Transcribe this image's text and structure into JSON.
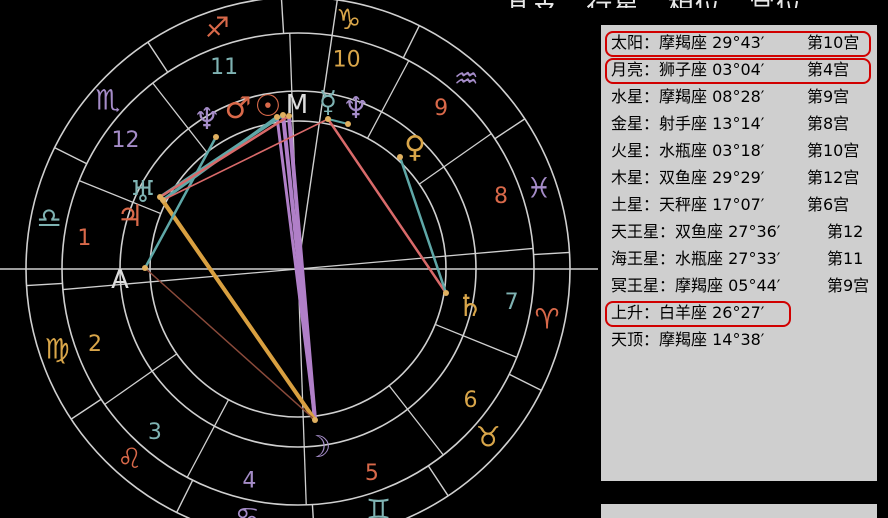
{
  "tabs": [
    "其支",
    "行星",
    "相位",
    "宫位"
  ],
  "planet_rows": [
    {
      "label": "太阳：摩羯座 29°43′",
      "house": "第10宫",
      "highlight": true
    },
    {
      "label": "月亮：狮子座 03°04′",
      "house": "第4宫",
      "highlight": true
    },
    {
      "label": "水星：摩羯座 08°28′",
      "house": "第9宫",
      "highlight": false
    },
    {
      "label": "金星：射手座 13°14′",
      "house": "第8宫",
      "highlight": false
    },
    {
      "label": "火星：水瓶座 03°18′",
      "house": "第10宫",
      "highlight": false
    },
    {
      "label": "木星：双鱼座 29°29′",
      "house": "第12宫",
      "highlight": false
    },
    {
      "label": "土星：天秤座 17°07′",
      "house": "第6宫",
      "highlight": false
    },
    {
      "label": "天王星：双鱼座 27°36′",
      "house": "第12",
      "highlight": false
    },
    {
      "label": "海王星：水瓶座 27°33′",
      "house": "第11",
      "highlight": false
    },
    {
      "label": "冥王星：摩羯座 05°44′",
      "house": "第9宫",
      "highlight": false
    },
    {
      "label": "上升：白羊座 26°27′",
      "house": "",
      "highlight": true
    },
    {
      "label": "天顶：摩羯座 14°38′",
      "house": "",
      "highlight": false
    }
  ],
  "wheel": {
    "zodiac_signs": [
      {
        "glyph": "♑",
        "color": "#d9a64a"
      },
      {
        "glyph": "♒",
        "color": "#a58cc8"
      },
      {
        "glyph": "♓",
        "color": "#a58cc8"
      },
      {
        "glyph": "♈",
        "color": "#d9694a"
      },
      {
        "glyph": "♉",
        "color": "#d9a64a"
      },
      {
        "glyph": "♊",
        "color": "#7fb3b3"
      },
      {
        "glyph": "♋",
        "color": "#a58cc8"
      },
      {
        "glyph": "♌",
        "color": "#d9694a"
      },
      {
        "glyph": "♍",
        "color": "#d9a64a"
      },
      {
        "glyph": "♎",
        "color": "#7fb3b3"
      },
      {
        "glyph": "♏",
        "color": "#a58cc8"
      },
      {
        "glyph": "♐",
        "color": "#d9694a"
      }
    ],
    "house_numbers": [
      {
        "label": "10",
        "color": "#d9a64a"
      },
      {
        "label": "9",
        "color": "#d9694a"
      },
      {
        "label": "8",
        "color": "#d9694a"
      },
      {
        "label": "7",
        "color": "#7fb3b3"
      },
      {
        "label": "6",
        "color": "#d9a64a"
      },
      {
        "label": "5",
        "color": "#d9694a"
      },
      {
        "label": "4",
        "color": "#a58cc8"
      },
      {
        "label": "3",
        "color": "#7fb3b3"
      },
      {
        "label": "2",
        "color": "#d9a64a"
      },
      {
        "label": "1",
        "color": "#d9694a"
      },
      {
        "label": "12",
        "color": "#a58cc8"
      },
      {
        "label": "11",
        "color": "#7fb3b3"
      }
    ],
    "planets": [
      {
        "name": "sun",
        "glyph": "☉",
        "color": "#d9694a"
      },
      {
        "name": "mars",
        "glyph": "♂",
        "color": "#d9694a"
      },
      {
        "name": "neptune-a",
        "glyph": "♆",
        "color": "#a58cc8"
      },
      {
        "name": "midheaven",
        "glyph": "M",
        "color": "#dddddd"
      },
      {
        "name": "mercury",
        "glyph": "☿",
        "color": "#7fb3b3"
      },
      {
        "name": "neptune-b",
        "glyph": "♆",
        "color": "#a58cc8"
      },
      {
        "name": "venus",
        "glyph": "♀",
        "color": "#d9a64a"
      },
      {
        "name": "saturn",
        "glyph": "♄",
        "color": "#d9a64a"
      },
      {
        "name": "moon",
        "glyph": "☽",
        "color": "#a58cc8"
      },
      {
        "name": "ascendant",
        "glyph": "A",
        "color": "#dddddd"
      },
      {
        "name": "uranus",
        "glyph": "♅",
        "color": "#7fb3b3"
      },
      {
        "name": "jupiter",
        "glyph": "♃",
        "color": "#d9694a"
      }
    ],
    "aspect_colors": {
      "purple": "#b07fc8",
      "orange": "#d9a040",
      "teal": "#5fa8a8",
      "red": "#d96a6a",
      "darkred": "#8a4a3a"
    }
  }
}
